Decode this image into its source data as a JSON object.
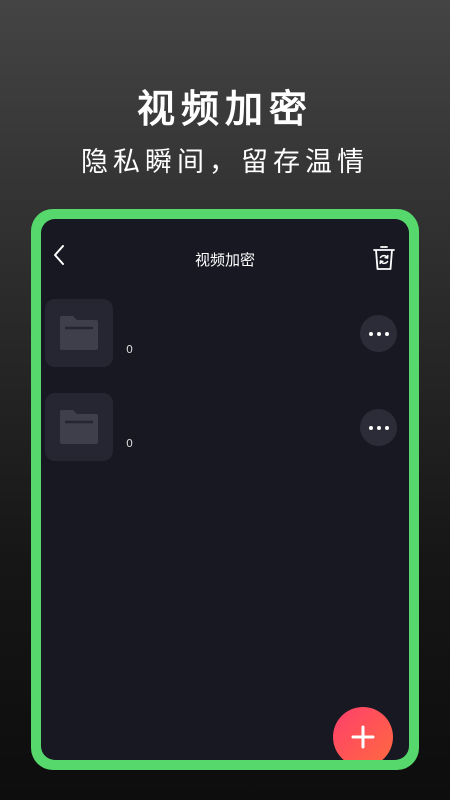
{
  "promo": {
    "title": "视频加密",
    "subtitle": "隐私瞬间，留存温情"
  },
  "screen": {
    "nav": {
      "back_icon": "chevron-left-icon",
      "title": "视频加密",
      "trash_icon": "trash-restore-icon"
    },
    "folders": [
      {
        "icon": "folder-icon",
        "count": "0",
        "more_icon": "more-dots-icon"
      },
      {
        "icon": "folder-icon",
        "count": "0",
        "more_icon": "more-dots-icon"
      }
    ],
    "add_icon": "plus-icon"
  },
  "colors": {
    "frame_green": "#56d86c",
    "screen_bg": "#171822",
    "thumb_bg": "#252631",
    "add_gradient_start": "#ff3f6c",
    "add_gradient_end": "#ff6a3f"
  }
}
